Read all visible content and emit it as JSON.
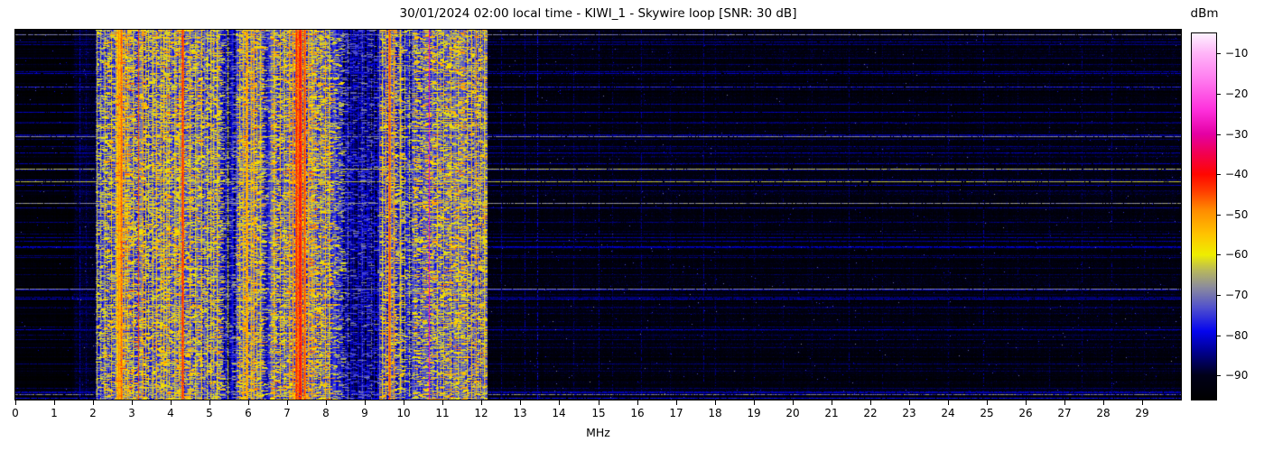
{
  "chart_data": {
    "type": "heatmap",
    "subtype": "radio-spectrogram",
    "title": "30/01/2024 02:00 local time - KIWI_1 - Skywire loop [SNR: 30 dB]",
    "xlabel": "MHz",
    "x_range": [
      0,
      30
    ],
    "x_ticks": [
      0,
      1,
      2,
      3,
      4,
      5,
      6,
      7,
      8,
      9,
      10,
      11,
      12,
      13,
      14,
      15,
      16,
      17,
      18,
      19,
      20,
      21,
      22,
      23,
      24,
      25,
      26,
      27,
      28,
      29
    ],
    "y_axis": "time (no tick labels shown)",
    "colorbar": {
      "label": "dBm",
      "vmin": -96,
      "vmax": -5,
      "ticks": [
        -10,
        -20,
        -30,
        -40,
        -50,
        -60,
        -70,
        -80,
        -90
      ],
      "gradient_stops": [
        [
          -96,
          "#000000"
        ],
        [
          -90,
          "#000018"
        ],
        [
          -84,
          "#000092"
        ],
        [
          -79,
          "#0404ee"
        ],
        [
          -73,
          "#5252cc"
        ],
        [
          -68,
          "#8c8c9c"
        ],
        [
          -64,
          "#b6b65e"
        ],
        [
          -60,
          "#eeee00"
        ],
        [
          -55,
          "#ffc400"
        ],
        [
          -49,
          "#ff8c00"
        ],
        [
          -44,
          "#ff3a00"
        ],
        [
          -40,
          "#ff0600"
        ],
        [
          -35,
          "#f2004e"
        ],
        [
          -30,
          "#e400a4"
        ],
        [
          -24,
          "#fe30dc"
        ],
        [
          -16,
          "#ff80f0"
        ],
        [
          -10,
          "#ffb4f8"
        ],
        [
          -5,
          "#fdf2ff"
        ]
      ]
    },
    "noise_floor_bands": [
      [
        0,
        1.5,
        -95,
        0.3,
        3
      ],
      [
        1.5,
        2.05,
        -91,
        0.35,
        4
      ],
      [
        2.05,
        2.55,
        -79,
        0.26,
        20
      ],
      [
        2.55,
        2.95,
        -75,
        0.34,
        22
      ],
      [
        2.95,
        4.55,
        -77,
        0.3,
        21
      ],
      [
        4.55,
        5.3,
        -78,
        0.27,
        20
      ],
      [
        5.3,
        5.65,
        -85,
        0.14,
        14
      ],
      [
        5.65,
        6.35,
        -76,
        0.3,
        21
      ],
      [
        6.35,
        6.55,
        -83,
        0.16,
        15
      ],
      [
        6.55,
        8.1,
        -76,
        0.3,
        21
      ],
      [
        8.1,
        8.4,
        -81,
        0.2,
        16
      ],
      [
        8.4,
        9.35,
        -86,
        0.14,
        12
      ],
      [
        9.35,
        9.95,
        -78,
        0.28,
        20
      ],
      [
        9.95,
        10.2,
        -83,
        0.16,
        14
      ],
      [
        10.2,
        12.15,
        -77,
        0.28,
        20
      ],
      [
        12.15,
        30,
        -93.5,
        0.45,
        4
      ]
    ],
    "carriers": [
      [
        1.64,
        1,
        -82,
        0.7
      ],
      [
        1.82,
        1,
        -85,
        0.6
      ],
      [
        2.08,
        1,
        -60,
        0.9
      ],
      [
        2.18,
        1,
        -64,
        0.8
      ],
      [
        2.31,
        1,
        -62,
        0.8
      ],
      [
        2.46,
        1,
        -57,
        0.85
      ],
      [
        2.6,
        1,
        -55,
        0.9
      ],
      [
        2.66,
        2,
        -50,
        0.95
      ],
      [
        2.73,
        2,
        -46,
        0.95
      ],
      [
        2.81,
        1,
        -54,
        0.9
      ],
      [
        2.89,
        1,
        -59,
        0.85
      ],
      [
        3.03,
        1,
        -62,
        0.8
      ],
      [
        3.16,
        1,
        -45,
        0.95
      ],
      [
        3.27,
        1,
        -52,
        0.9
      ],
      [
        3.34,
        1,
        -56,
        0.85
      ],
      [
        3.42,
        1,
        -59,
        0.8
      ],
      [
        3.53,
        1,
        -57,
        0.85
      ],
      [
        3.63,
        1,
        -54,
        0.9
      ],
      [
        3.74,
        1,
        -59,
        0.8
      ],
      [
        3.81,
        1,
        -56,
        0.85
      ],
      [
        3.89,
        1,
        -61,
        0.8
      ],
      [
        3.96,
        1,
        -58,
        0.85
      ],
      [
        4.08,
        1,
        -62,
        0.8
      ],
      [
        4.2,
        1,
        -57,
        0.85
      ],
      [
        4.31,
        2,
        -42,
        0.95
      ],
      [
        4.48,
        1,
        -55,
        0.85
      ],
      [
        4.62,
        1,
        -60,
        0.8
      ],
      [
        4.78,
        1,
        -56,
        0.85
      ],
      [
        4.93,
        1,
        -61,
        0.8
      ],
      [
        5.01,
        1,
        -57,
        0.85
      ],
      [
        5.1,
        1,
        -60,
        0.8
      ],
      [
        5.19,
        1,
        -58,
        0.8
      ],
      [
        5.47,
        1,
        -61,
        0.75
      ],
      [
        5.76,
        1,
        -58,
        0.85
      ],
      [
        5.86,
        1,
        -54,
        0.9
      ],
      [
        5.96,
        2,
        -50,
        0.9
      ],
      [
        6.06,
        1,
        -55,
        0.85
      ],
      [
        6.13,
        1,
        -52,
        0.9
      ],
      [
        6.2,
        1,
        -57,
        0.85
      ],
      [
        6.3,
        1,
        -60,
        0.8
      ],
      [
        6.64,
        1,
        -58,
        0.85
      ],
      [
        6.81,
        1,
        -55,
        0.85
      ],
      [
        6.93,
        1,
        -60,
        0.8
      ],
      [
        7.05,
        1,
        -52,
        0.9
      ],
      [
        7.13,
        1,
        -48,
        0.92
      ],
      [
        7.22,
        2,
        -42,
        0.95
      ],
      [
        7.31,
        3,
        -38,
        0.97
      ],
      [
        7.43,
        2,
        -44,
        0.95
      ],
      [
        7.54,
        1,
        -52,
        0.9
      ],
      [
        7.63,
        1,
        -56,
        0.85
      ],
      [
        7.86,
        1,
        -57,
        0.85
      ],
      [
        7.96,
        1,
        -55,
        0.85
      ],
      [
        8.06,
        1,
        -60,
        0.8
      ],
      [
        8.55,
        1,
        -70,
        0.6
      ],
      [
        8.92,
        1,
        -73,
        0.5
      ],
      [
        9.16,
        1,
        -71,
        0.5
      ],
      [
        9.43,
        1,
        -58,
        0.85
      ],
      [
        9.53,
        1,
        -52,
        0.9
      ],
      [
        9.63,
        2,
        -45,
        0.95
      ],
      [
        9.74,
        1,
        -50,
        0.9
      ],
      [
        9.89,
        1,
        -57,
        0.85
      ],
      [
        10.02,
        1,
        -63,
        0.7
      ],
      [
        10.13,
        1,
        -61,
        0.7
      ],
      [
        10.65,
        1,
        -28,
        0.98
      ],
      [
        10.86,
        1,
        -58,
        0.8
      ],
      [
        11.01,
        1,
        -60,
        0.75
      ],
      [
        11.19,
        1,
        -57,
        0.8
      ],
      [
        11.39,
        1,
        -62,
        0.7
      ],
      [
        11.61,
        1,
        -57,
        0.8
      ],
      [
        11.74,
        1,
        -54,
        0.85
      ],
      [
        11.86,
        1,
        -52,
        0.85
      ],
      [
        11.96,
        1,
        -56,
        0.8
      ],
      [
        12.06,
        1,
        -58,
        0.8
      ],
      [
        12.5,
        1,
        -85,
        0.7
      ],
      [
        13.1,
        1,
        -84,
        0.7
      ],
      [
        13.42,
        1,
        -80,
        0.5
      ],
      [
        14.37,
        1,
        -86,
        0.6
      ],
      [
        15.0,
        1,
        -85,
        0.6
      ],
      [
        15.35,
        1,
        -87,
        0.5
      ],
      [
        16.1,
        1,
        -85,
        0.6
      ],
      [
        16.85,
        1,
        -88,
        0.5
      ],
      [
        17.7,
        1,
        -85,
        0.6
      ],
      [
        18.02,
        1,
        -87,
        0.5
      ],
      [
        19.0,
        1,
        -88,
        0.45
      ],
      [
        19.75,
        1,
        -88,
        0.45
      ],
      [
        20.5,
        1,
        -88,
        0.45
      ],
      [
        21.45,
        1,
        -86,
        0.5
      ],
      [
        22.3,
        1,
        -88,
        0.45
      ],
      [
        23.1,
        1,
        -88,
        0.4
      ],
      [
        24.0,
        1,
        -87,
        0.45
      ],
      [
        24.9,
        1,
        -83,
        0.4
      ],
      [
        25.8,
        1,
        -88,
        0.4
      ],
      [
        26.6,
        1,
        -88,
        0.4
      ],
      [
        27.45,
        1,
        -86,
        0.45
      ],
      [
        28.2,
        1,
        -84,
        0.4
      ],
      [
        29.05,
        1,
        -88,
        0.4
      ]
    ],
    "time_lines": {
      "strong": [
        [
          0.012,
          -70,
          3
        ],
        [
          0.117,
          -81,
          2
        ],
        [
          0.154,
          -77,
          3
        ],
        [
          0.288,
          -69,
          3
        ],
        [
          0.376,
          -63,
          2.5
        ],
        [
          0.41,
          -64,
          2.5
        ],
        [
          0.468,
          -68,
          3
        ],
        [
          0.7,
          -69,
          3
        ],
        [
          0.986,
          -72,
          8
        ],
        [
          0.995,
          -79,
          3
        ]
      ],
      "weak_count": 46
    },
    "seed": 1234
  }
}
